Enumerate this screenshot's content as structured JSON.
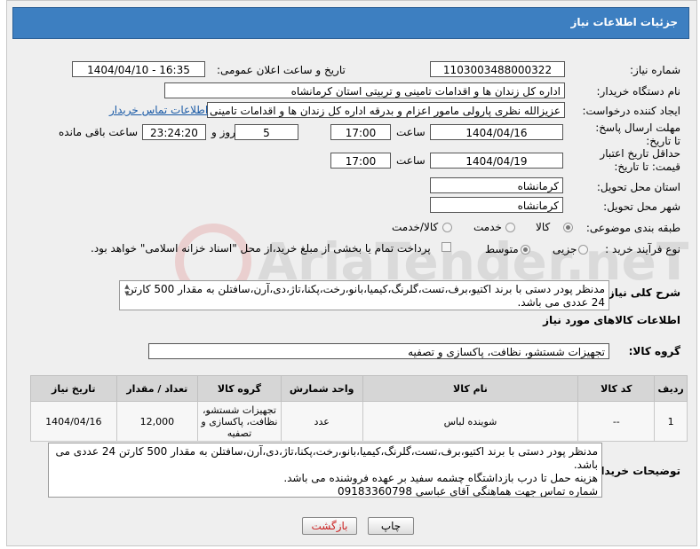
{
  "header": {
    "title": "جزئیات اطلاعات نیاز"
  },
  "fields": {
    "need_number_label": "شماره نیاز:",
    "need_number": "1103003488000322",
    "announce_label": "تاریخ و ساعت اعلان عمومی:",
    "announce_value": "1404/04/10 - 16:35",
    "buyer_org_label": "نام دستگاه خریدار:",
    "buyer_org": "اداره کل زندان ها و اقدامات تامینی و تربیتی استان کرمانشاه",
    "requester_label": "ایجاد کننده درخواست:",
    "requester": "عزیزالله نظری پارولی مامور اعزام و بدرقه اداره کل زندان ها و اقدامات تامینی و تر",
    "buyer_contact_link": "اطلاعات تماس خریدار",
    "deadline_label": "مهلت ارسال پاسخ: تا تاریخ:",
    "deadline_date": "1404/04/16",
    "hour_label": "ساعت",
    "deadline_time": "17:00",
    "days_value": "5",
    "days_label": "روز و",
    "remaining_time": "23:24:20",
    "remaining_label": "ساعت باقی مانده",
    "validity_label": "حداقل تاریخ اعتبار قیمت: تا تاریخ:",
    "validity_date": "1404/04/19",
    "validity_time": "17:00",
    "province_label": "استان محل تحویل:",
    "province": "کرمانشاه",
    "city_label": "شهر محل تحویل:",
    "city": "کرمانشاه",
    "category_label": "طبقه بندی موضوعی:",
    "category_options": [
      "کالا",
      "خدمت",
      "کالا/خدمت"
    ],
    "process_label": "نوع فرآیند خرید :",
    "process_options": [
      "جزیی",
      "متوسط"
    ],
    "payment_note": "پرداخت تمام یا بخشی از مبلغ خرید،از محل \"اسناد خزانه اسلامی\" خواهد بود."
  },
  "general_desc": {
    "label": "شرح کلی نیاز:",
    "text": "مدنظر پودر دستی با برند اکتیو،برف،تست،گلرنگ،کیمیا،بانو،رخت،پکنا،تاژ،دی،آرن،سافتلن به مقدار 500 کارتن 24 عددی می باشد."
  },
  "goods_info": {
    "title": "اطلاعات کالاهای مورد نیاز",
    "group_label": "گروه کالا:",
    "group_value": "تجهیزات شستشو، نظافت، پاکسازی و تصفیه"
  },
  "table": {
    "headers": [
      "ردیف",
      "کد کالا",
      "نام کالا",
      "واحد شمارش",
      "گروه کالا",
      "تعداد / مقدار",
      "تاریخ نیاز"
    ],
    "rows": [
      [
        "1",
        "--",
        "شوینده لباس",
        "عدد",
        "تجهیزات شستشو، نظافت، پاکسازی و تصفیه",
        "12,000",
        "1404/04/16"
      ]
    ]
  },
  "buyer_notes": {
    "label": "توضیحات خریدار:",
    "lines": [
      "مدنظر پودر دستی با برند اکتیو،برف،تست،گلرنگ،کیمیا،بانو،رخت،پکنا،تاژ،دی،آرن،سافتلن به مقدار 500 کارتن 24 عددی می باشد.",
      "هزینه حمل تا درب بازداشتگاه چشمه سفید بر عهده فروشنده می باشد.",
      "شماره تماس جهت هماهنگی آقای عباسی 09183360798"
    ]
  },
  "buttons": {
    "print": "چاپ",
    "back": "بازگشت"
  },
  "watermark": {
    "text": "AriaTender.neT"
  }
}
